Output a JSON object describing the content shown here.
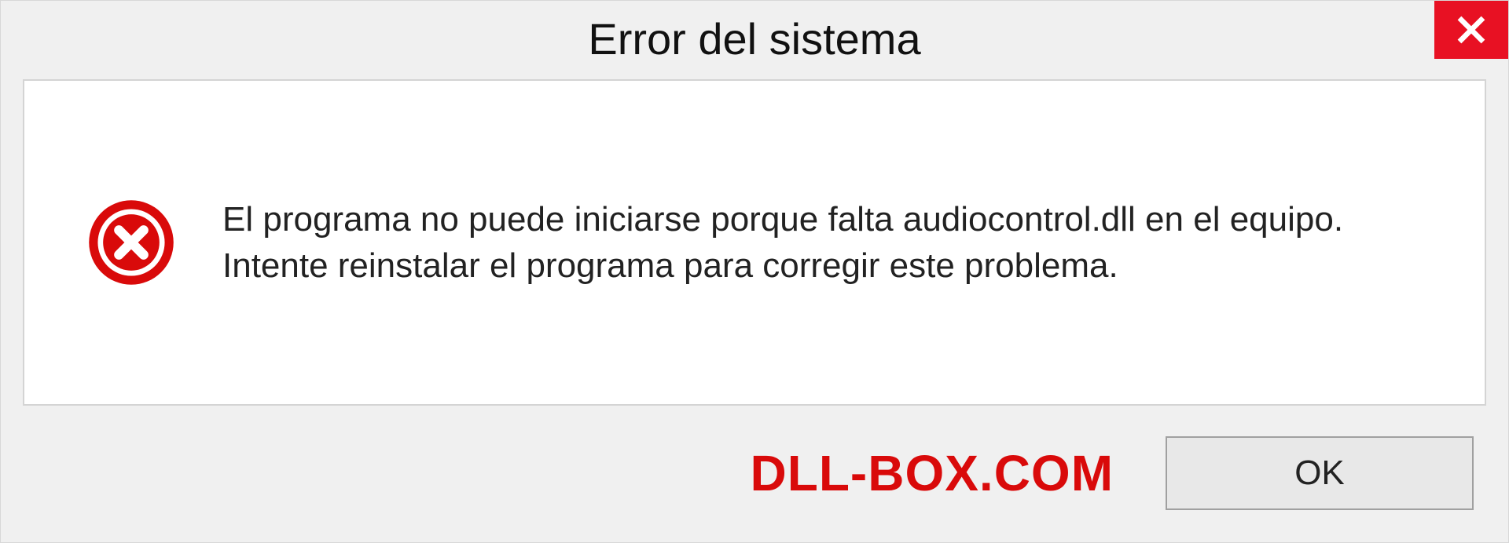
{
  "dialog": {
    "title": "Error del sistema",
    "message": "El programa no puede iniciarse porque falta audiocontrol.dll en el equipo. Intente reinstalar el programa para corregir este problema.",
    "ok_label": "OK"
  },
  "watermark": "DLL-BOX.COM",
  "icons": {
    "close": "close-icon",
    "error": "error-circle-x-icon"
  },
  "colors": {
    "close_bg": "#e81123",
    "error_icon": "#d90a0a",
    "watermark": "#d90a0a"
  }
}
